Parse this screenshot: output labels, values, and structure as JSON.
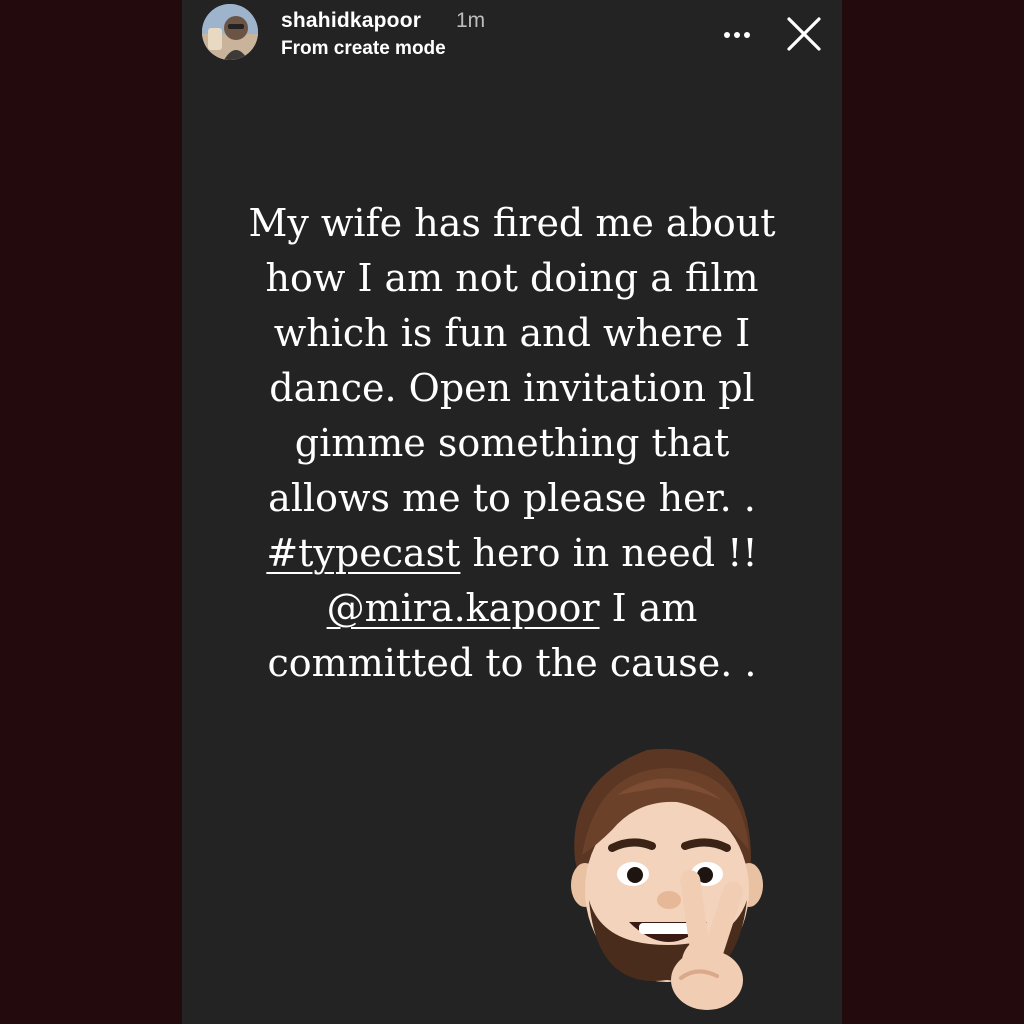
{
  "story": {
    "username": "shahidkapoor",
    "time_ago": "1m",
    "subtitle": "From create mode",
    "more_label": "•••",
    "close_label": "✕",
    "lines": [
      {
        "before": "My wife has fired me about",
        "tag": "",
        "after": ""
      },
      {
        "before": "how I am not doing a film",
        "tag": "",
        "after": ""
      },
      {
        "before": "which is fun and where I",
        "tag": "",
        "after": ""
      },
      {
        "before": "dance. Open invitation pl",
        "tag": "",
        "after": ""
      },
      {
        "before": "gimme something that",
        "tag": "",
        "after": ""
      },
      {
        "before": "allows me to please her. .",
        "tag": "",
        "after": ""
      },
      {
        "before": "",
        "tag": "#typecast",
        "after": " hero in need !!"
      },
      {
        "before": "",
        "tag": "@mira.kapoor",
        "after": " I am"
      },
      {
        "before": "committed to the cause. .",
        "tag": "",
        "after": ""
      }
    ],
    "icons": {
      "avatar": "profile-avatar",
      "more": "more-options-icon",
      "close": "close-icon",
      "sticker": "memoji-peace-sign-sticker"
    },
    "colors": {
      "outer_background": "#230b0d",
      "story_background": "#232323",
      "text": "#ffffff"
    }
  }
}
